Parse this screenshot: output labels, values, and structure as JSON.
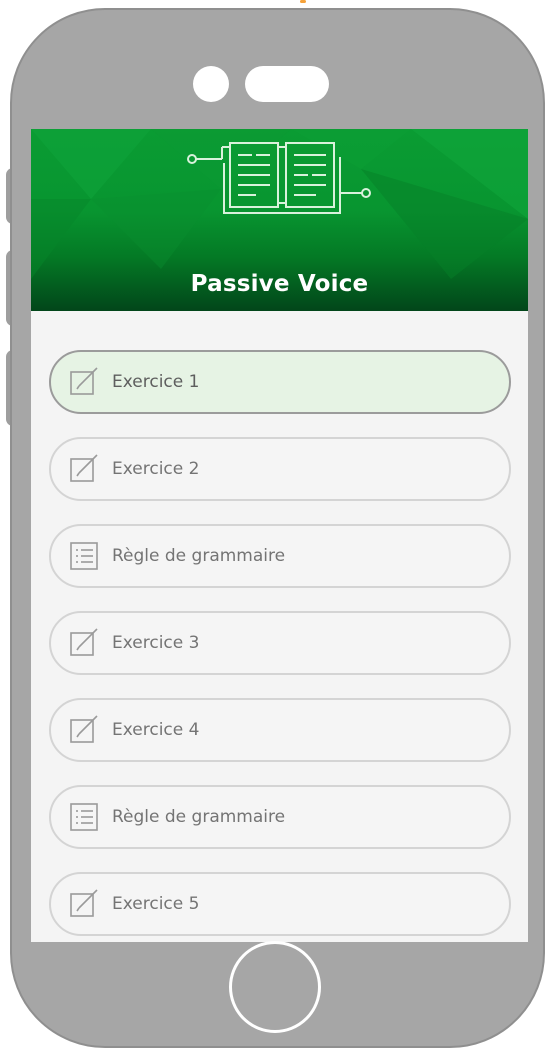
{
  "screen": {
    "header": {
      "title": "Passive Voice",
      "icon": "book-circuit-icon",
      "background_color": "#089530"
    },
    "items": [
      {
        "label": "Exercice 1",
        "icon": "edit-icon",
        "active": true
      },
      {
        "label": "Exercice 2",
        "icon": "edit-icon",
        "active": false
      },
      {
        "label": "Règle de grammaire",
        "icon": "list-icon",
        "active": false
      },
      {
        "label": "Exercice 3",
        "icon": "edit-icon",
        "active": false
      },
      {
        "label": "Exercice 4",
        "icon": "edit-icon",
        "active": false
      },
      {
        "label": "Règle de grammaire",
        "icon": "list-icon",
        "active": false
      },
      {
        "label": "Exercice 5",
        "icon": "edit-icon",
        "active": false
      }
    ]
  },
  "colors": {
    "accent_green": "#089530",
    "active_item_bg": "#e6f3e4",
    "phone_frame": "#a6a6a6"
  }
}
